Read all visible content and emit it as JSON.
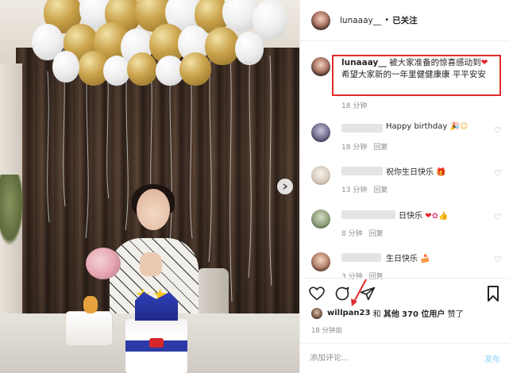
{
  "post": {
    "username": "lunaaay__",
    "separator": "•",
    "follow_label": "已关注"
  },
  "caption": {
    "username": "lunaaay__",
    "text": "被大家准备的惊喜感动到",
    "line2": "希望大家新的一年里健健康康 平平安安",
    "time": "18 分钟"
  },
  "comments": [
    {
      "text": "Happy birthday",
      "emoji": [
        "party-hat-emoji",
        "smiling-face-emoji"
      ],
      "time": "18 分钟",
      "reply": "回复"
    },
    {
      "text": "祝你生日快乐",
      "emoji": [
        "gift-emoji"
      ],
      "time": "13 分钟",
      "reply": "回复"
    },
    {
      "text": "日快乐",
      "emoji": [
        "heart-emoji",
        "flower-emoji",
        "thumbs-up-emoji"
      ],
      "time": "8 分钟",
      "reply": "回复"
    },
    {
      "text": "生日快乐",
      "emoji": [
        "cake-emoji"
      ],
      "time": "3 分钟",
      "reply": "回复"
    }
  ],
  "likes": {
    "liker": "willpan23",
    "and": "和",
    "others": "其他",
    "count_text": "370 位用户",
    "suffix": "赞了"
  },
  "post_time": "18 分钟前",
  "add_comment": {
    "placeholder": "添加评论...",
    "publish_label": "发布"
  },
  "colors": {
    "accent_blue": "#b2dffc",
    "annotation_red": "#e02b2b",
    "meta_gray": "#8e8e8e"
  }
}
